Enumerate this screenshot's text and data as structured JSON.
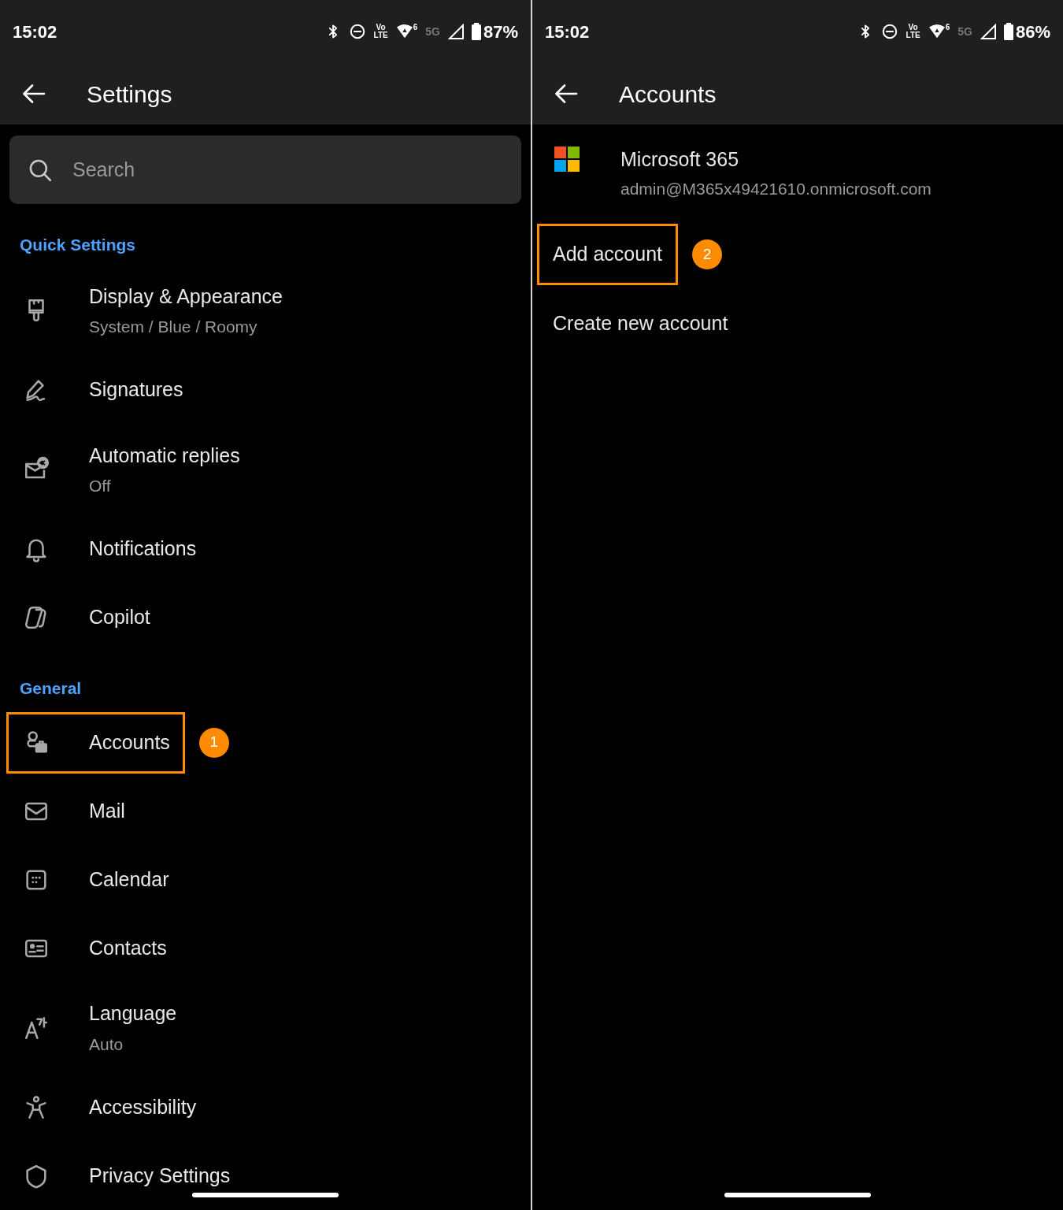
{
  "panels": [
    {
      "status_bar": {
        "time": "15:02",
        "volte_top": "Vo",
        "volte_bottom": "LTE",
        "wifi_tag": "6",
        "network": "5G",
        "battery": "87%"
      },
      "header": {
        "title": "Settings"
      },
      "search": {
        "placeholder": "Search"
      },
      "sections": [
        {
          "title": "Quick Settings",
          "items": [
            {
              "label": "Display & Appearance",
              "subtitle": "System / Blue / Roomy",
              "highlighted": false
            },
            {
              "label": "Signatures",
              "highlighted": false
            },
            {
              "label": "Automatic replies",
              "subtitle": "Off",
              "highlighted": false
            },
            {
              "label": "Notifications",
              "highlighted": false
            },
            {
              "label": "Copilot",
              "highlighted": false
            }
          ]
        },
        {
          "title": "General",
          "items": [
            {
              "label": "Accounts",
              "highlighted": true,
              "callout": "1"
            },
            {
              "label": "Mail",
              "highlighted": false
            },
            {
              "label": "Calendar",
              "highlighted": false
            },
            {
              "label": "Contacts",
              "highlighted": false
            },
            {
              "label": "Language",
              "subtitle": "Auto",
              "highlighted": false
            },
            {
              "label": "Accessibility",
              "highlighted": false
            },
            {
              "label": "Privacy Settings",
              "highlighted": false
            }
          ]
        }
      ]
    },
    {
      "status_bar": {
        "time": "15:02",
        "volte_top": "Vo",
        "volte_bottom": "LTE",
        "wifi_tag": "6",
        "network": "5G",
        "battery": "86%"
      },
      "header": {
        "title": "Accounts"
      },
      "account": {
        "name": "Microsoft 365",
        "email": "admin@M365x49421610.onmicrosoft.com"
      },
      "actions": [
        {
          "label": "Add account",
          "highlighted": true,
          "callout": "2"
        },
        {
          "label": "Create new account",
          "highlighted": false
        }
      ]
    }
  ]
}
